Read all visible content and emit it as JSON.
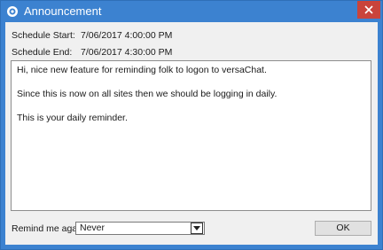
{
  "window": {
    "title": "Announcement",
    "close_label": "×"
  },
  "schedule": {
    "start_label": "Schedule Start:",
    "start_value": "7/06/2017 4:00:00 PM",
    "end_label": "Schedule End:",
    "end_value": "7/06/2017 4:30:00 PM"
  },
  "message": {
    "lines": [
      "Hi, nice new feature for reminding folk to logon to versaChat.",
      "Since this is now on all sites then we should be logging in daily.",
      "This is your daily reminder."
    ]
  },
  "footer": {
    "remind_label": "Remind me again:",
    "remind_value": "Never",
    "ok_label": "OK"
  },
  "colors": {
    "titlebar": "#3c82d0",
    "close": "#c9443b"
  }
}
